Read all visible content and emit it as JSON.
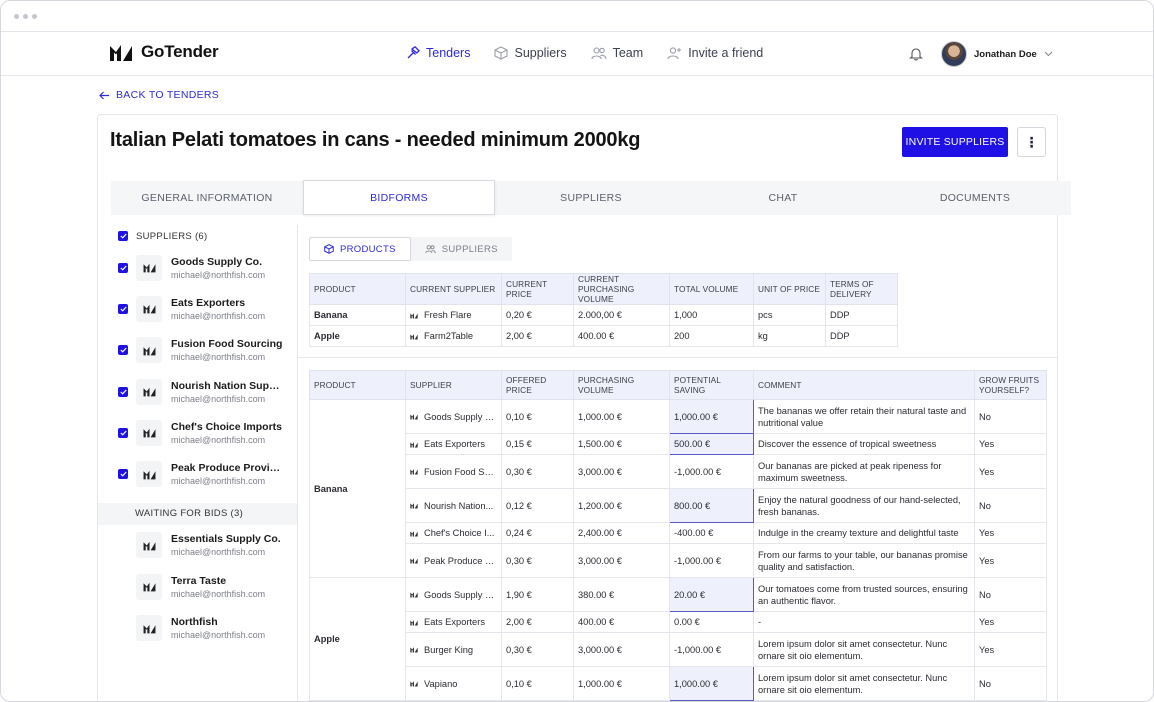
{
  "app": {
    "brand": "GoTender",
    "nav": [
      {
        "label": "Tenders",
        "icon": "hammer-icon",
        "active": true
      },
      {
        "label": "Suppliers",
        "icon": "box-icon",
        "active": false
      },
      {
        "label": "Team",
        "icon": "team-icon",
        "active": false
      },
      {
        "label": "Invite a friend",
        "icon": "user-plus-icon",
        "active": false
      }
    ],
    "user_name": "Jonathan Doe"
  },
  "page": {
    "back_label": "BACK TO TENDERS",
    "title": "Italian Pelati tomatoes in cans - needed minimum 2000kg",
    "invite_label": "INVITE SUPPLIERS",
    "more_label": "⋮",
    "accent": "#1f10e6",
    "tabs": [
      "GENERAL INFORMATION",
      "BIDFORMS",
      "SUPPLIERS",
      "CHAT",
      "DOCUMENTS"
    ]
  },
  "sidebar": {
    "suppliers_header": "SUPPLIERS (6)",
    "suppliers": [
      {
        "name": "Goods Supply Co.",
        "email": "michael@northfish.com"
      },
      {
        "name": "Eats Exporters",
        "email": "michael@northfish.com"
      },
      {
        "name": "Fusion Food Sourcing",
        "email": "michael@northfish.com"
      },
      {
        "name": "Nourish Nation Suppli...",
        "email": "michael@northfish.com"
      },
      {
        "name": "Chef's Choice Imports",
        "email": "michael@northfish.com"
      },
      {
        "name": "Peak Produce Provid...",
        "email": "michael@northfish.com"
      }
    ],
    "waiting_header": "WAITING FOR BIDS (3)",
    "waiting": [
      {
        "name": "Essentials Supply Co.",
        "email": "michael@northfish.com"
      },
      {
        "name": "Terra Taste",
        "email": "michael@northfish.com"
      },
      {
        "name": "Northfish",
        "email": "michael@northfish.com"
      }
    ]
  },
  "bidforms": {
    "seg_products": "PRODUCTS",
    "seg_suppliers": "SUPPLIERS",
    "summary_headers": [
      "PRODUCT",
      "CURRENT SUPPLIER",
      "CURRENT PRICE",
      "CURRENT PURCHASING VOLUME",
      "TOTAL VOLUME",
      "UNIT OF PRICE",
      "TERMS OF DELIVERY"
    ],
    "summary_rows": [
      [
        "Banana",
        "Fresh Flare",
        "0,20 €",
        "2.000,00 €",
        "1,000",
        "pcs",
        "DDP"
      ],
      [
        "Apple",
        "Farm2Table",
        "2,00 €",
        "400.00 €",
        "200",
        "kg",
        "DDP"
      ]
    ],
    "bid_headers": [
      "PRODUCT",
      "SUPPLIER",
      "OFFERED PRICE",
      "PURCHASING VOLUME",
      "POTENTIAL SAVING",
      "COMMENT",
      "GROW FRUITS YOURSELF?"
    ],
    "groups": [
      {
        "product": "Banana",
        "rows": [
          {
            "supplier": "Goods Supply C...",
            "price": "0,10 €",
            "volume": "1,000.00 €",
            "saving": "1,000.00 €",
            "highlight": true,
            "comment": "The bananas we offer retain their natural taste and nutritional value",
            "grow": "No",
            "h": 34
          },
          {
            "supplier": "Eats Exporters",
            "price": "0,15 €",
            "volume": "1,500.00 €",
            "saving": "500.00 €",
            "highlight": true,
            "comment": "Discover the essence of tropical sweetness",
            "grow": "Yes",
            "h": 21
          },
          {
            "supplier": "Fusion Food Sou...",
            "price": "0,30 €",
            "volume": "3,000.00 €",
            "saving": "-1,000.00 €",
            "highlight": false,
            "comment": "Our bananas are picked at peak ripeness for maximum sweetness.",
            "grow": "Yes",
            "h": 34
          },
          {
            "supplier": "Nourish Nation...",
            "price": "0,12 €",
            "volume": "1,200.00 €",
            "saving": "800.00 €",
            "highlight": true,
            "comment": "Enjoy the natural goodness of our hand-selected, fresh bananas.",
            "grow": "No",
            "h": 34
          },
          {
            "supplier": "Chef's Choice I...",
            "price": "0,24 €",
            "volume": "2,400.00 €",
            "saving": "-400.00 €",
            "highlight": false,
            "comment": "Indulge in the creamy texture and delightful taste",
            "grow": "Yes",
            "h": 21
          },
          {
            "supplier": "Peak Produce Pr...",
            "price": "0,30 €",
            "volume": "3,000.00 €",
            "saving": "-1,000.00 €",
            "highlight": false,
            "comment": "From our farms to your table, our bananas promise quality and satisfaction.",
            "grow": "Yes",
            "h": 34
          }
        ]
      },
      {
        "product": "Apple",
        "rows": [
          {
            "supplier": "Goods Supply C...",
            "price": "1,90 €",
            "volume": "380.00 €",
            "saving": "20.00 €",
            "highlight": true,
            "comment": "Our tomatoes come from trusted sources, ensuring an authentic flavor.",
            "grow": "No",
            "h": 34
          },
          {
            "supplier": "Eats Exporters",
            "price": "2,00 €",
            "volume": "400.00 €",
            "saving": "0.00 €",
            "highlight": false,
            "comment": "-",
            "grow": "Yes",
            "h": 21
          },
          {
            "supplier": "Burger King",
            "price": "0,30 €",
            "volume": "3,000.00 €",
            "saving": "-1,000.00 €",
            "highlight": false,
            "comment": "Lorem ipsum dolor sit amet consectetur. Nunc ornare sit oio elementum.",
            "grow": "Yes",
            "h": 34
          },
          {
            "supplier": "Vapiano",
            "price": "0,10 €",
            "volume": "1,000.00 €",
            "saving": "1,000.00 €",
            "highlight": true,
            "comment": "Lorem ipsum dolor sit amet consectetur. Nunc ornare sit oio elementum.",
            "grow": "No",
            "h": 34
          }
        ]
      }
    ]
  }
}
